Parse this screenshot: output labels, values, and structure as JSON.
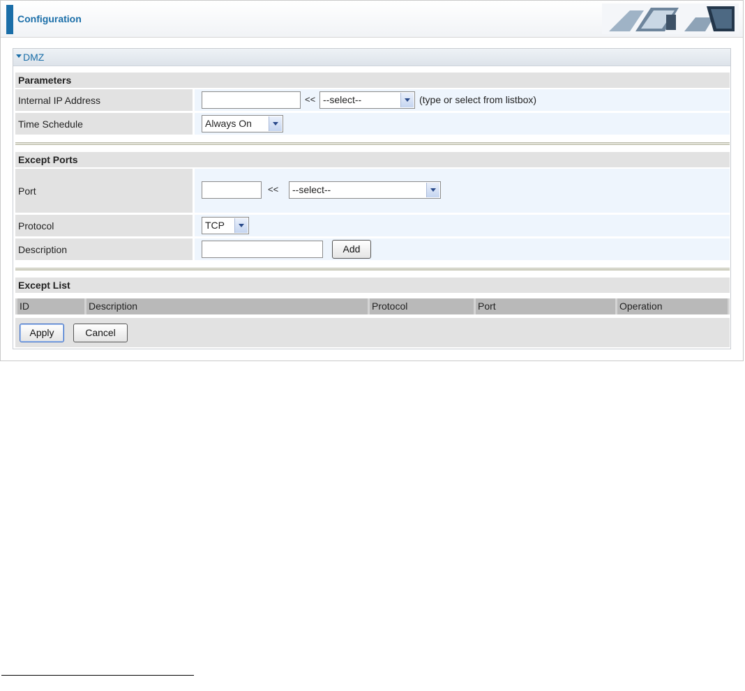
{
  "header": {
    "title": "Configuration"
  },
  "dmz": {
    "label": "DMZ"
  },
  "parameters": {
    "heading": "Parameters",
    "internal_ip": {
      "label": "Internal IP Address",
      "value": "",
      "arrow": "<<",
      "select": "--select--",
      "hint": "(type or select from listbox)"
    },
    "time_schedule": {
      "label": "Time Schedule",
      "select": "Always On"
    }
  },
  "except_ports": {
    "heading": "Except Ports",
    "port": {
      "label": "Port",
      "value": "",
      "arrow": "<<",
      "select": "--select--"
    },
    "protocol": {
      "label": "Protocol",
      "select": "TCP"
    },
    "description": {
      "label": "Description",
      "value": "",
      "add_label": "Add"
    }
  },
  "except_list": {
    "heading": "Except List",
    "columns": [
      "ID",
      "Description",
      "Protocol",
      "Port",
      "Operation"
    ]
  },
  "buttons": {
    "apply": "Apply",
    "cancel": "Cancel"
  },
  "colors": {
    "accent": "#1a6ea8",
    "section": "#e2e2e2",
    "value_bg": "#eef5fd"
  },
  "icons": {
    "collapse": "triangle-down-icon",
    "dropdown": "chevron-down-icon"
  }
}
